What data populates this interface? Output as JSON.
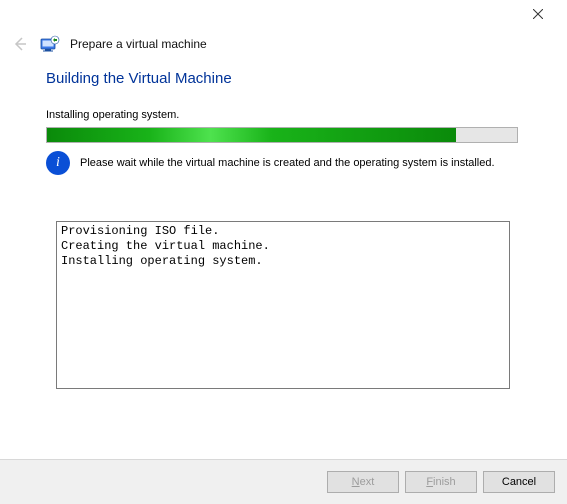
{
  "window": {
    "title": "Prepare a virtual machine"
  },
  "page": {
    "heading": "Building the Virtual Machine",
    "status": "Installing operating system.",
    "progress_percent": 87,
    "info_text": "Please wait while the virtual machine is created and the operating system is installed.",
    "log": "Provisioning ISO file.\nCreating the virtual machine.\nInstalling operating system."
  },
  "buttons": {
    "next": "Next",
    "finish": "Finish",
    "cancel": "Cancel"
  }
}
